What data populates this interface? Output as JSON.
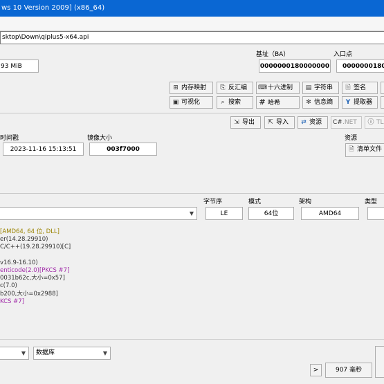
{
  "window": {
    "title": "ws 10 Version 2009] (x86_64)"
  },
  "file": {
    "path": "sktop\\Down\\qiplus5-x64.api"
  },
  "info": {
    "size_value": "93 MiB",
    "base_label": "基址（BA）",
    "base_value": "0000000180000000",
    "entry_label": "入口点",
    "entry_value": "00000001800"
  },
  "toolbar": {
    "row1": [
      {
        "icon": "⊞",
        "icon_name": "memory-map-icon",
        "label": "内存映射"
      },
      {
        "icon": "⎘",
        "icon_name": "disassemble-icon",
        "label": "反汇编"
      },
      {
        "icon": "⌨",
        "icon_name": "hex-icon",
        "label": "十六进制"
      },
      {
        "icon": "▤",
        "icon_name": "strings-icon",
        "label": "字符串"
      },
      {
        "icon": "🗎",
        "icon_name": "signature-icon",
        "label": "签名"
      }
    ],
    "row2": [
      {
        "icon": "▣",
        "icon_name": "visualize-icon",
        "label": "可视化"
      },
      {
        "icon": "🔍",
        "icon_name": "search-icon",
        "label": "搜索"
      },
      {
        "icon": "#",
        "icon_name": "hash-icon",
        "label": "哈希"
      },
      {
        "icon": "✻",
        "icon_name": "entropy-icon",
        "label": "信息熵"
      },
      {
        "icon": "Y",
        "icon_name": "extractor-icon",
        "label": "提取器"
      }
    ]
  },
  "actions": {
    "export": "导出",
    "import": "导入",
    "resources": "资源",
    "dotnet": ".NET",
    "tls": "TL"
  },
  "timestamps": {
    "time_label": "时间戳",
    "time_value": "2023-11-16 15:13:51",
    "image_size_label": "镜像大小",
    "image_size_value": "003f7000",
    "resources_label": "资源",
    "manifest_button": "清单文件"
  },
  "arch": {
    "endian_label": "字节序",
    "endian_value": "LE",
    "mode_label": "模式",
    "mode_value": "64位",
    "arch_label": "架构",
    "arch_value": "AMD64",
    "type_label": "类型"
  },
  "log": [
    {
      "text": "[AMD64, 64 位, DLL]",
      "color": "olive"
    },
    {
      "text": "er(14.28.29910)",
      "color": "dark"
    },
    {
      "text": "C/C++(19.28.29910)[C]",
      "color": "dark"
    },
    {
      "text": "",
      "color": "dark"
    },
    {
      "text": "v16.9-16.10)",
      "color": "dark"
    },
    {
      "text": "enticode(2.0)[PKCS #7]",
      "color": "purple"
    },
    {
      "text": "0031b62c,大小=0x57]",
      "color": "dark"
    },
    {
      "text": "c(7.0)",
      "color": "dark"
    },
    {
      "text": "b200,大小=0x2988]",
      "color": "dark"
    },
    {
      "text": "KCS #7]",
      "color": "purple"
    }
  ],
  "bottom": {
    "db_combo": "数据库",
    "next_button": ">",
    "duration": "907 毫秒"
  }
}
